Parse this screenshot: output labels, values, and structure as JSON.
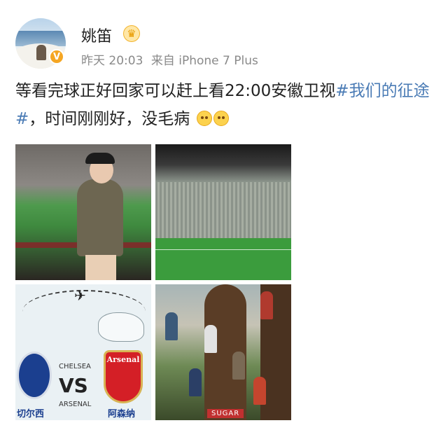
{
  "post": {
    "author": {
      "name": "姚笛",
      "verified_badge": "V",
      "badge_icon": "crown-icon"
    },
    "meta": {
      "time": "昨天 20:03",
      "source": "来自 iPhone 7 Plus"
    },
    "text_part1": "等看完球正好回家可以赶上看22:00安徽卫视",
    "hashtag": "#我们的征途#",
    "text_part2": "，时间刚刚好，没毛病",
    "emojis": [
      "grinning-emoji",
      "kiss-emoji"
    ]
  },
  "photos": {
    "p3": {
      "team_left": "CHELSEA",
      "vs": "VS",
      "team_right": "ARSENAL",
      "club_right_badge": "Arsenal",
      "cn_left": "切尔西",
      "cn_right": "阿森纳"
    },
    "p4": {
      "logo": "SUGAR"
    }
  },
  "colors": {
    "link": "#4a7bb5",
    "meta": "#8a8a8a",
    "badge": "#f5a623"
  }
}
